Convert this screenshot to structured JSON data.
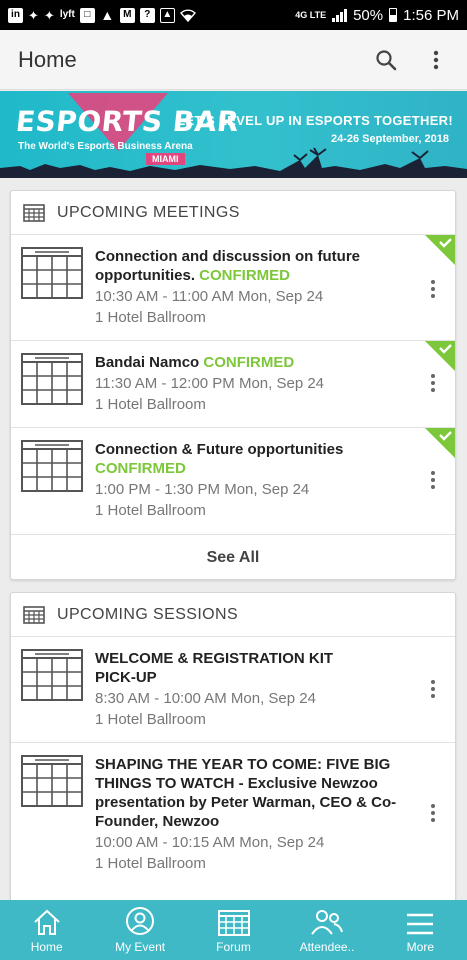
{
  "status_bar": {
    "network": "4G LTE",
    "battery": "50%",
    "time": "1:56 PM",
    "left_icons": [
      "linkedin-icon",
      "twitter-icon",
      "twitter-icon",
      "lyft-icon",
      "twitch-icon",
      "alert-icon",
      "gmail-icon",
      "help-icon",
      "photo-icon",
      "wifi-icon"
    ]
  },
  "appbar": {
    "title": "Home",
    "icons": [
      "search-icon",
      "more-vert-icon"
    ]
  },
  "banner": {
    "title": "ESPORTS BAR",
    "subtitle": "The World's Esports Business Arena",
    "city": "MIAMI",
    "tagline": "LET'S LEVEL UP IN ESPORTS TOGETHER!",
    "dates": "24-26 September, 2018"
  },
  "meetings": {
    "header": "UPCOMING MEETINGS",
    "see_all": "See All",
    "items": [
      {
        "title": "Connection and discussion on future opportunities.",
        "status": "CONFIRMED",
        "time": "10:30 AM - 11:00 AM Mon, Sep 24",
        "location": "1 Hotel Ballroom"
      },
      {
        "title": "Bandai Namco",
        "status": "CONFIRMED",
        "time": "11:30 AM - 12:00 PM Mon, Sep 24",
        "location": "1 Hotel Ballroom"
      },
      {
        "title": "Connection & Future opportunities",
        "status": "CONFIRMED",
        "time": "1:00 PM - 1:30 PM Mon, Sep 24",
        "location": "1 Hotel Ballroom"
      }
    ]
  },
  "sessions": {
    "header": "UPCOMING SESSIONS",
    "items": [
      {
        "title": "WELCOME & REGISTRATION KIT PICK-UP",
        "time": "8:30 AM - 10:00 AM Mon, Sep 24",
        "location": "1 Hotel Ballroom"
      },
      {
        "title": "SHAPING THE YEAR TO COME: FIVE BIG THINGS TO WATCH - Exclusive Newzoo presentation by Peter Warman, CEO & Co-Founder, Newzoo",
        "time": "10:00 AM - 10:15 AM Mon, Sep 24",
        "location": "1 Hotel Ballroom"
      }
    ]
  },
  "bottom_nav": [
    {
      "label": "Home",
      "icon": "home-icon"
    },
    {
      "label": "My Event",
      "icon": "person-icon"
    },
    {
      "label": "Forum",
      "icon": "grid-icon"
    },
    {
      "label": "Attendee..",
      "icon": "people-icon"
    },
    {
      "label": "More",
      "icon": "menu-icon"
    }
  ],
  "colors": {
    "accent": "#3fb9c6",
    "confirmed": "#7dc73a",
    "banner_pink": "#e2467f"
  }
}
